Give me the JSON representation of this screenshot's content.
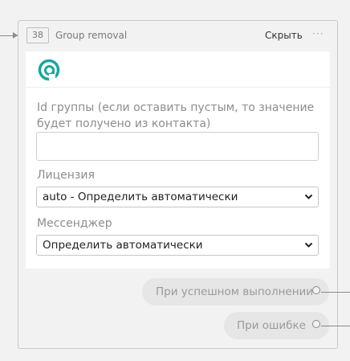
{
  "node": {
    "number": "38",
    "title": "Group removal",
    "hide_label": "Скрыть",
    "menu_icon": "ellipsis-icon"
  },
  "logo": {
    "icon": "app-logo-icon",
    "color": "#1aa6a0"
  },
  "fields": {
    "group_id": {
      "label": "Id группы (если оставить пустым, то значение будет получено из контакта)",
      "value": "",
      "placeholder": ""
    },
    "license": {
      "label": "Лицензия",
      "selected": "auto - Определить автоматически"
    },
    "messenger": {
      "label": "Мессенджер",
      "selected": "Определить автоматически"
    }
  },
  "outputs": {
    "success": "При успешном выполнении",
    "error": "При ошибке"
  },
  "colors": {
    "background": "#f2f2f2",
    "panel": "#ffffff",
    "pill": "#e6e6e6",
    "connector": "#8a8a8a"
  }
}
